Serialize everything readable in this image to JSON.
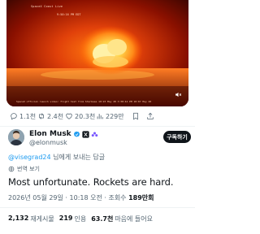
{
  "video": {
    "overlay_label": "SpaceX Coast Live",
    "overlay_time": "9:50:16 PM EDT",
    "caption": "SpaceX official launch video: flight test from Starbase 10:23 May 28 3:38:44 PM 18:07 May 28"
  },
  "actions": {
    "replies": "1.1천",
    "reposts": "2.4천",
    "likes": "20.3천",
    "views": "229만"
  },
  "author": {
    "name": "Elon Musk",
    "handle": "@elonmusk",
    "follow_label": "구독하기"
  },
  "reply_to": {
    "mention": "@visegrad24",
    "suffix": " 님에게 보내는 답글"
  },
  "translate_label": "번역 보기",
  "tweet_text": "Most unfortunate. Rockets are hard.",
  "meta": {
    "date": "2026년 05월 29일 · 10:18 오전 · 조회수 ",
    "views": "189만회"
  },
  "stats": {
    "reposts_count": "2,132",
    "reposts_label": "재게시물",
    "quotes_count": "219",
    "quotes_label": "인용",
    "likes_count": "63.7천",
    "likes_label": "마음에 들어요"
  },
  "colors": {
    "accent": "#1d9bf0",
    "text": "#0f1419",
    "secondary": "#536471",
    "verified": "#1d9bf0",
    "video_fire": "#ff9a20"
  }
}
